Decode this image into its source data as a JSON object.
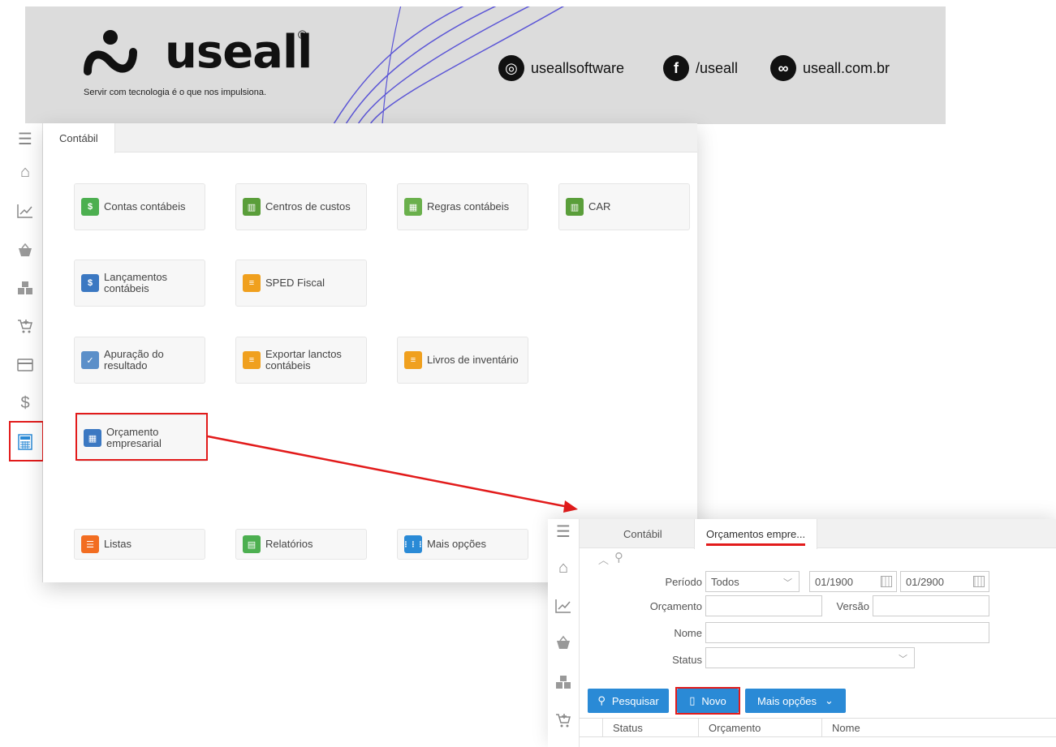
{
  "banner": {
    "brand": "useall",
    "registered": "®",
    "slogan": "Servir com tecnologia é o que nos impulsiona.",
    "social": [
      {
        "icon": "instagram-icon",
        "glyph": "◎",
        "label": "useallsoftware"
      },
      {
        "icon": "facebook-icon",
        "glyph": "f",
        "label": "/useall"
      },
      {
        "icon": "link-icon",
        "glyph": "∞",
        "label": "useall.com.br"
      }
    ]
  },
  "sidebar": {
    "items": [
      {
        "icon": "menu-icon",
        "glyph": "☰"
      },
      {
        "icon": "home-icon",
        "glyph": "⌂"
      },
      {
        "icon": "chart-icon",
        "glyph": "📈"
      },
      {
        "icon": "basket-icon",
        "glyph": "⛟"
      },
      {
        "icon": "boxes-icon",
        "glyph": "▦"
      },
      {
        "icon": "cart-icon",
        "glyph": "🛒"
      },
      {
        "icon": "card-icon",
        "glyph": "▭"
      },
      {
        "icon": "dollar-icon",
        "glyph": "$"
      },
      {
        "icon": "calculator-icon",
        "glyph": "▦"
      }
    ]
  },
  "main": {
    "tab": "Contábil",
    "tiles": [
      {
        "name": "tile-contas-contabeis",
        "label": "Contas contábeis",
        "icon": "green-ledger-icon",
        "color": "#4caf50",
        "glyph": "$"
      },
      {
        "name": "tile-centros-de-custos",
        "label": "Centros de custos",
        "icon": "green-chart-doc-icon",
        "color": "#5a9e3a",
        "glyph": "▥"
      },
      {
        "name": "tile-regras-contabeis",
        "label": "Regras contábeis",
        "icon": "green-grid-icon",
        "color": "#6ab04c",
        "glyph": "▦"
      },
      {
        "name": "tile-car",
        "label": "CAR",
        "icon": "green-chart-doc-icon",
        "color": "#5a9e3a",
        "glyph": "▥"
      },
      {
        "name": "tile-lancamentos-contabeis",
        "label": "Lançamentos contábeis",
        "icon": "blue-entries-icon",
        "color": "#3b78c2",
        "glyph": "$"
      },
      {
        "name": "tile-sped-fiscal",
        "label": "SPED Fiscal",
        "icon": "orange-doc-icon",
        "color": "#f0a01e",
        "glyph": "≡"
      },
      {
        "name": "tile-apuracao-do-resultado",
        "label": "Apuração do resultado",
        "icon": "blue-check-doc-icon",
        "color": "#5b8fc9",
        "glyph": "✓"
      },
      {
        "name": "tile-exportar-lanctos-contabeis",
        "label": "Exportar lanctos contábeis",
        "icon": "orange-doc-icon",
        "color": "#f0a01e",
        "glyph": "≡"
      },
      {
        "name": "tile-livros-de-inventario",
        "label": "Livros de inventário",
        "icon": "orange-doc-icon",
        "color": "#f0a01e",
        "glyph": "≡"
      },
      {
        "name": "tile-orcamento-empresarial",
        "label": "Orçamento empresarial",
        "icon": "blue-budget-icon",
        "color": "#3b78c2",
        "glyph": "▦"
      },
      {
        "name": "tile-listas",
        "label": "Listas",
        "icon": "orange-list-icon",
        "color": "#f26d21",
        "glyph": "☰"
      },
      {
        "name": "tile-relatorios",
        "label": "Relatórios",
        "icon": "green-report-icon",
        "color": "#4caf50",
        "glyph": "▤"
      },
      {
        "name": "tile-mais-opcoes",
        "label": "Mais opções",
        "icon": "blue-grid-icon",
        "color": "#2a8ad6",
        "glyph": "⋮⋮⋮"
      }
    ]
  },
  "panel2": {
    "tabs": [
      "Contábil",
      "Orçamentos empre..."
    ],
    "filters": {
      "periodo_label": "Período",
      "periodo_value": "Todos",
      "date_from": "01/1900",
      "date_to": "01/2900",
      "orcamento_label": "Orçamento",
      "versao_label": "Versão",
      "nome_label": "Nome",
      "status_label": "Status"
    },
    "buttons": {
      "pesquisar": "Pesquisar",
      "novo": "Novo",
      "mais_opcoes": "Mais opções"
    },
    "columns": [
      "Status",
      "Orçamento",
      "Nome"
    ]
  },
  "colors": {
    "accent": "#2a8ad6",
    "highlight": "#e21b1b",
    "banner_bg": "#dcdcdc"
  }
}
